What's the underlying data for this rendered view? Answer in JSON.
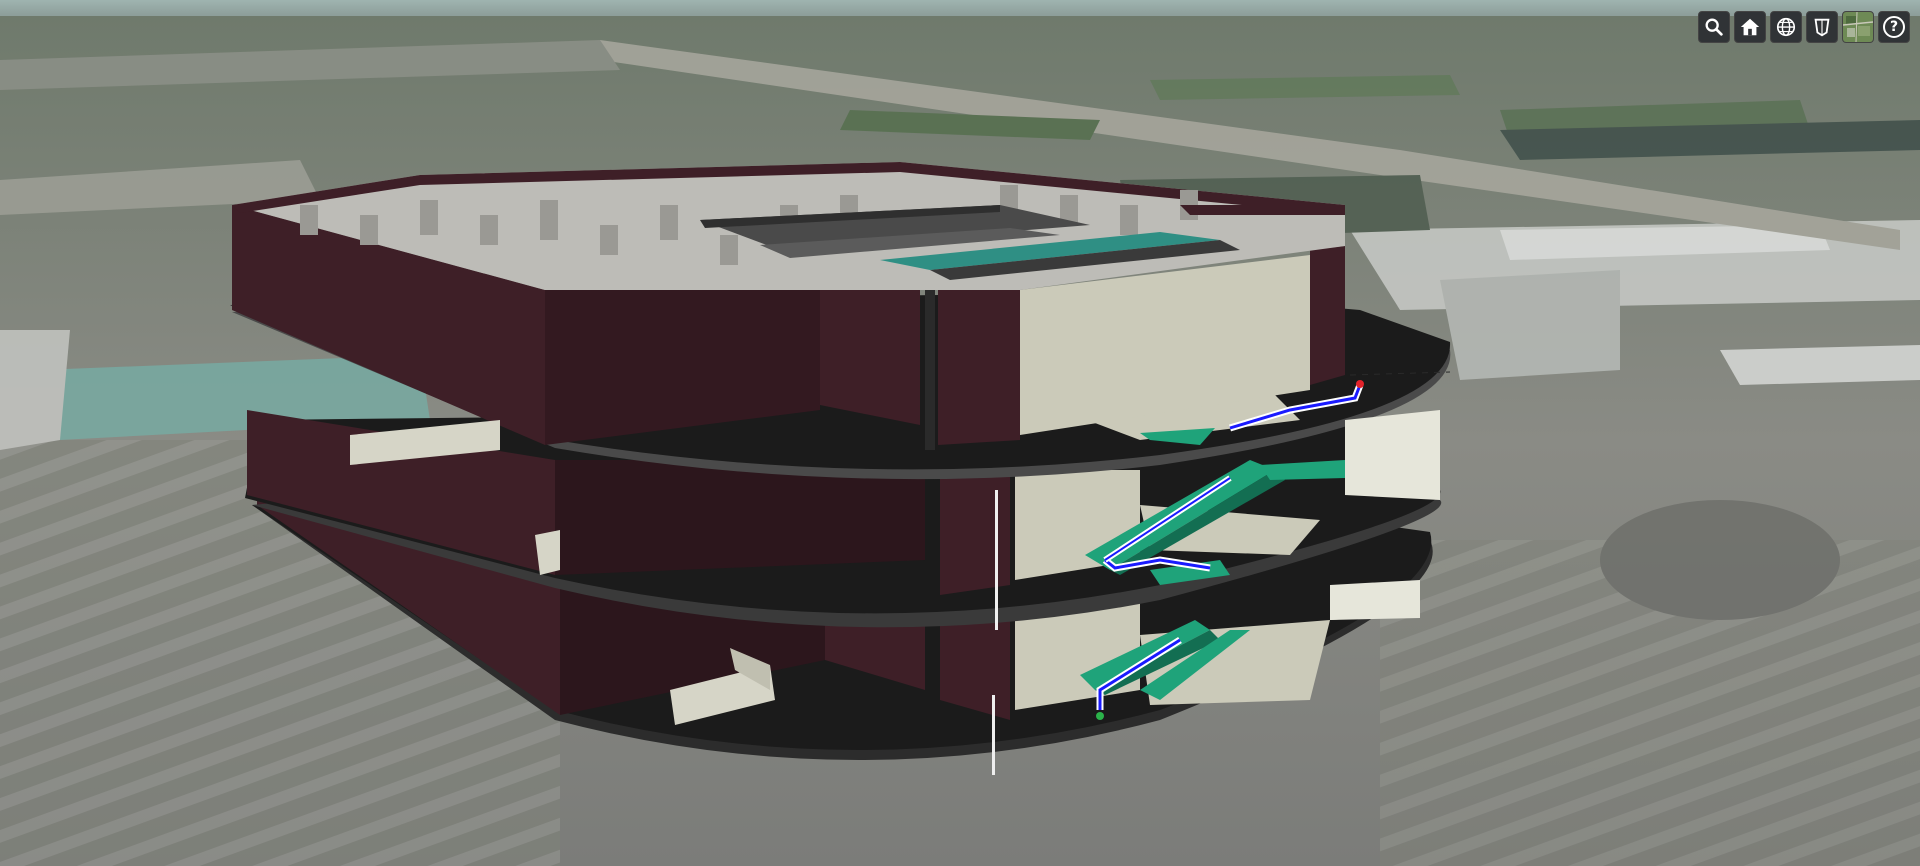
{
  "app": {
    "type": "3d-globe-viewer"
  },
  "toolbar": {
    "buttons": [
      {
        "name": "geocoder",
        "icon": "search-icon"
      },
      {
        "name": "home",
        "icon": "home-icon"
      },
      {
        "name": "scene-mode",
        "icon": "globe-icon"
      },
      {
        "name": "navigation",
        "icon": "shield-icon"
      },
      {
        "name": "base-layer-picker",
        "icon": "satellite-imagery-icon"
      },
      {
        "name": "help",
        "icon": "question-icon",
        "label": "?"
      }
    ]
  },
  "scene": {
    "model": "three-storey-building-cutaway",
    "floor_count": 3,
    "route_color": "#1a1aff",
    "route_outline": "#ffffff",
    "stair_color": "#1fa37a",
    "wall_color": "#3e1f27",
    "slab_color": "#1b1b1b",
    "interior_color": "#c9c8b8"
  }
}
